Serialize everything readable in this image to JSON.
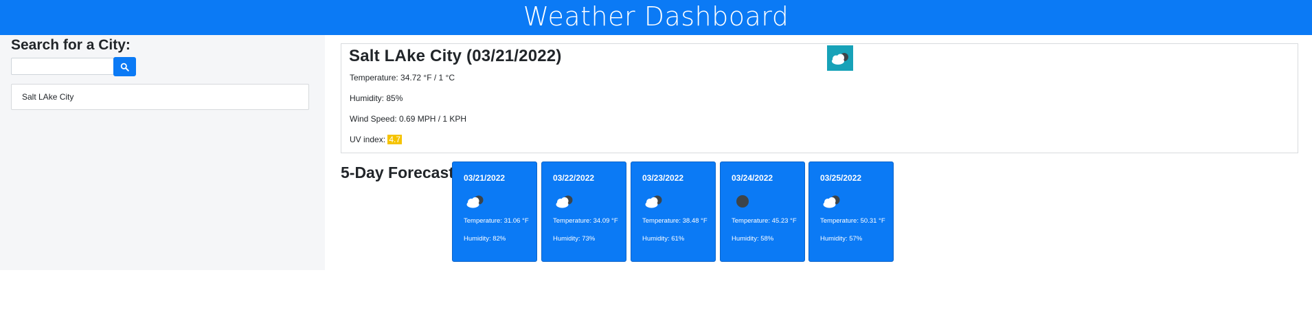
{
  "header": {
    "title": "Weather Dashboard"
  },
  "sidebar": {
    "search_label": "Search for a City:",
    "search_value": "",
    "search_button_icon": "search-icon",
    "history": [
      {
        "label": "Salt LAke City"
      }
    ]
  },
  "current": {
    "title": "Salt LAke City (03/21/2022)",
    "icon": "cloud-icon",
    "temperature": "Temperature: 34.72 °F / 1 °C",
    "humidity": "Humidity: 85%",
    "wind": "Wind Speed: 0.69 MPH / 1 KPH",
    "uv_label": "UV index:",
    "uv_value": "4.7"
  },
  "forecast": {
    "heading": "5-Day Forecast",
    "days": [
      {
        "date": "03/21/2022",
        "icon": "cloud-moon-icon",
        "temperature": "Temperature: 31.06 °F",
        "humidity": "Humidity: 82%"
      },
      {
        "date": "03/22/2022",
        "icon": "cloud-moon-icon",
        "temperature": "Temperature: 34.09 °F",
        "humidity": "Humidity: 73%"
      },
      {
        "date": "03/23/2022",
        "icon": "cloud-moon-icon",
        "temperature": "Temperature: 38.48 °F",
        "humidity": "Humidity: 61%"
      },
      {
        "date": "03/24/2022",
        "icon": "moon-icon",
        "temperature": "Temperature: 45.23 °F",
        "humidity": "Humidity: 58%"
      },
      {
        "date": "03/25/2022",
        "icon": "cloud-moon-icon",
        "temperature": "Temperature: 50.31 °F",
        "humidity": "Humidity: 57%"
      }
    ]
  },
  "colors": {
    "primary": "#0b7af5",
    "sidebar_bg": "#f5f6f8",
    "icon_bg": "#17a2b8",
    "uv_warning": "#f5c300"
  }
}
